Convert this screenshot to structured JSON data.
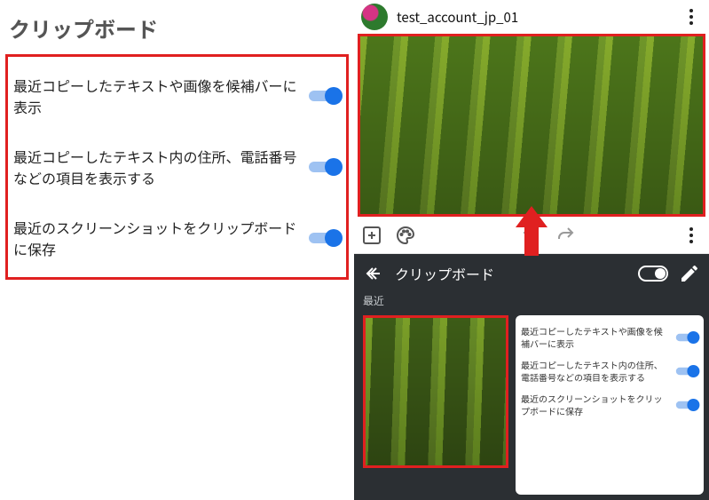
{
  "left": {
    "title": "クリップボード",
    "settings": [
      {
        "label": "最近コピーしたテキストや画像を候補バーに表示",
        "enabled": true
      },
      {
        "label": "最近コピーしたテキスト内の住所、電話番号などの項目を表示する",
        "enabled": true
      },
      {
        "label": "最近のスクリーンショットをクリップボードに保存",
        "enabled": true
      }
    ]
  },
  "right": {
    "account_name": "test_account_jp_01",
    "keyboard_title": "クリップボード",
    "recent_label": "最近",
    "clip_settings": [
      {
        "label": "最近コピーしたテキストや画像を候補バーに表示",
        "enabled": true
      },
      {
        "label": "最近コピーしたテキスト内の住所、電話番号などの項目を表示する",
        "enabled": true
      },
      {
        "label": "最近のスクリーンショットをクリップボードに保存",
        "enabled": true
      }
    ]
  },
  "colors": {
    "highlight": "#e02020",
    "accent": "#1a73e8"
  }
}
